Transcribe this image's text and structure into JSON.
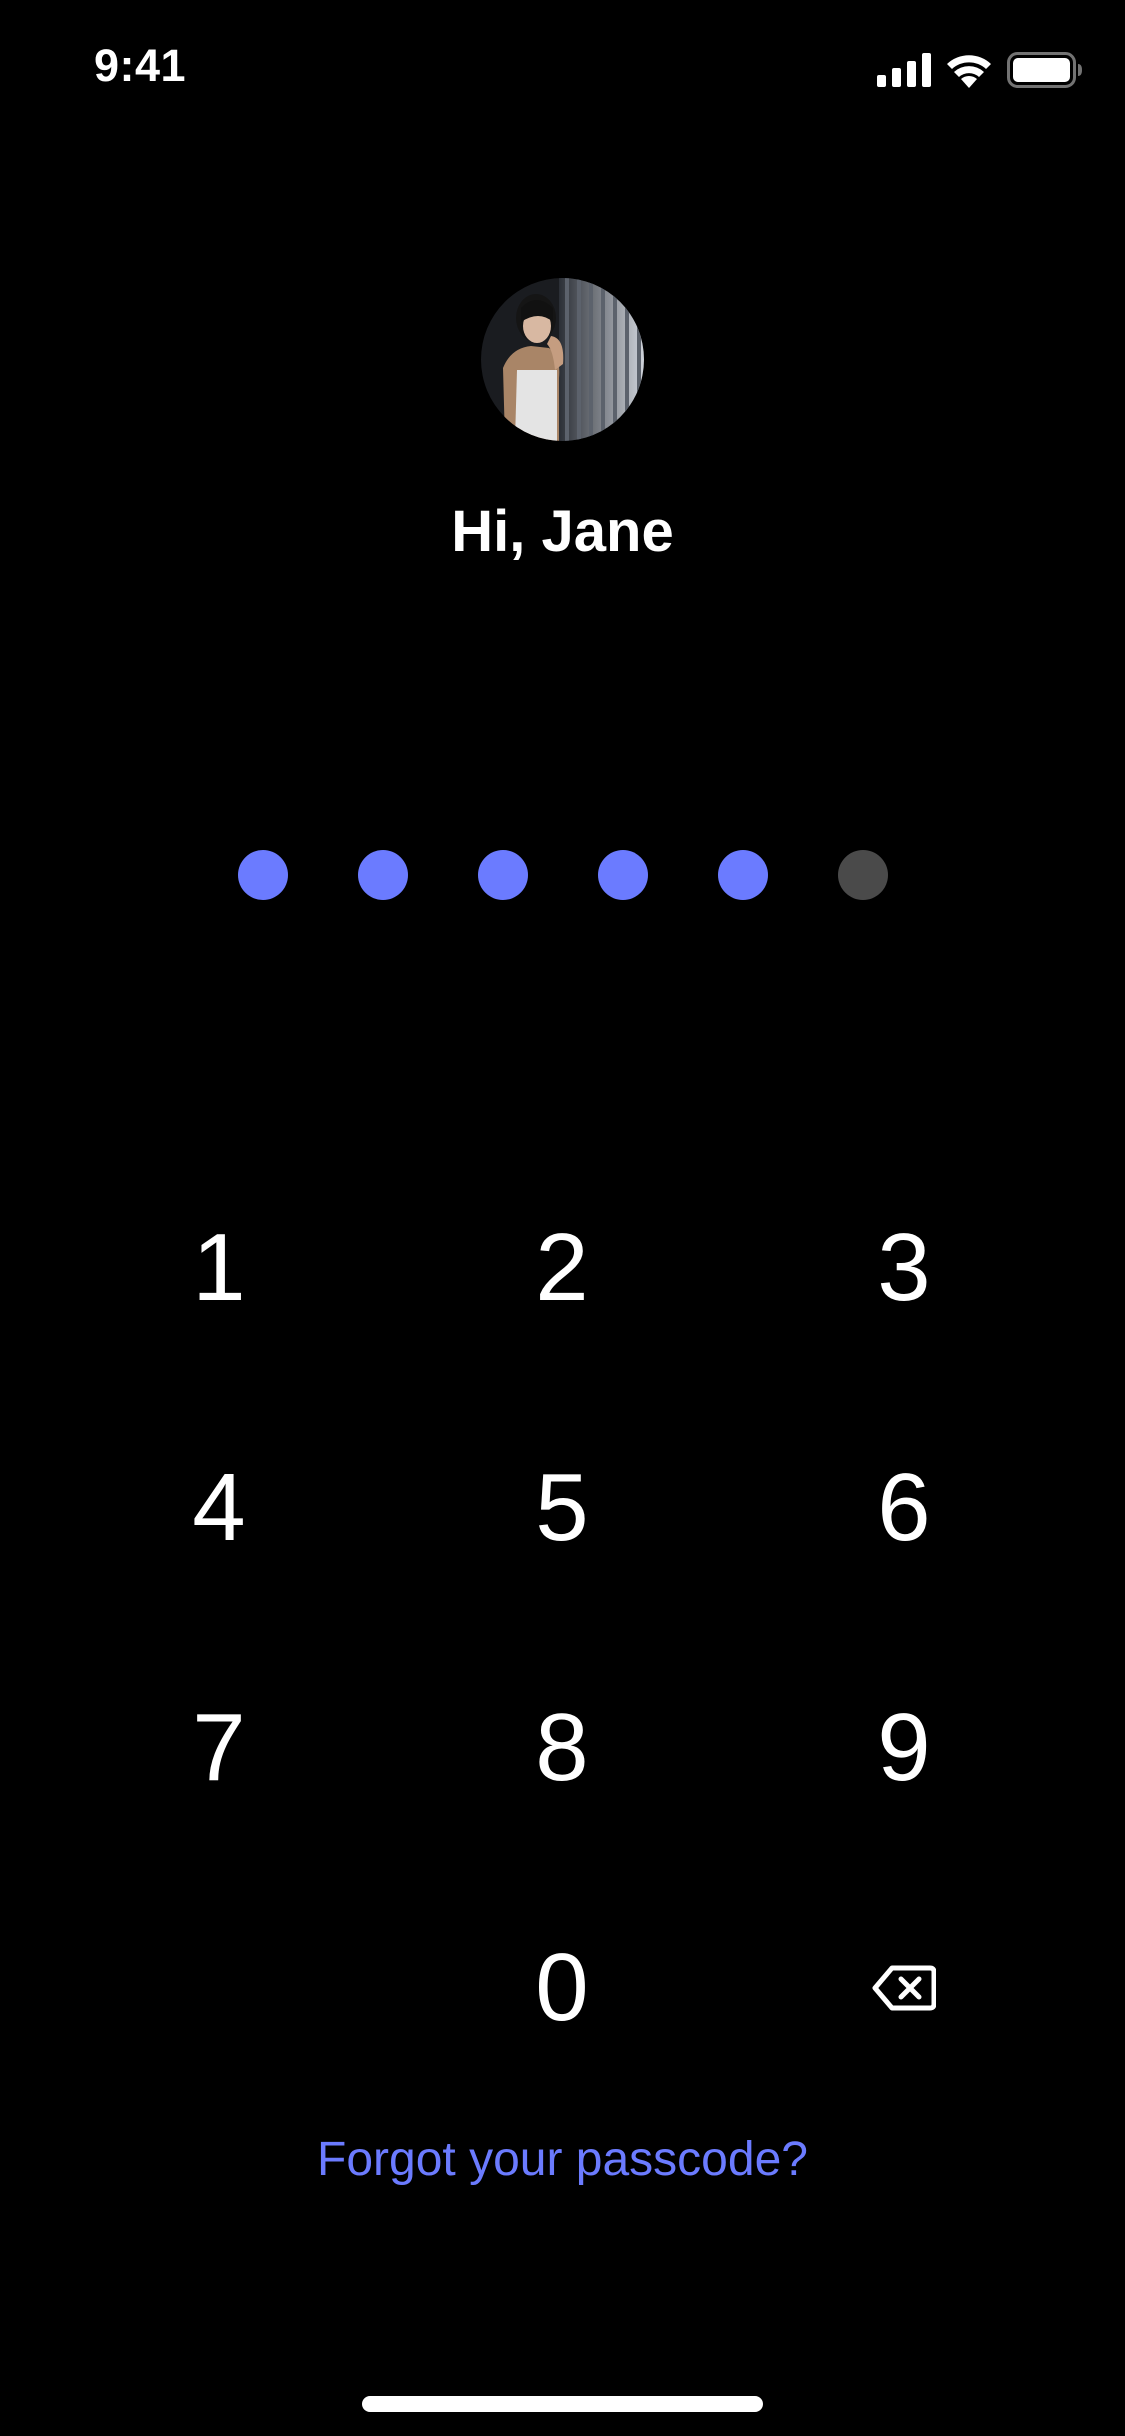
{
  "status_bar": {
    "time": "9:41",
    "icons": [
      "cellular-signal-icon",
      "wifi-icon",
      "battery-icon"
    ]
  },
  "profile": {
    "greeting": "Hi, Jane"
  },
  "passcode": {
    "length": 6,
    "entered": 5,
    "filled_color": "#6B7BFF",
    "empty_color": "#4A4A4A"
  },
  "keypad": {
    "keys": [
      "1",
      "2",
      "3",
      "4",
      "5",
      "6",
      "7",
      "8",
      "9",
      "0"
    ],
    "delete_icon": "backspace-icon"
  },
  "forgot_link": "Forgot your passcode?",
  "colors": {
    "background": "#000000",
    "accent": "#6B7BFF",
    "text": "#FFFFFF"
  }
}
